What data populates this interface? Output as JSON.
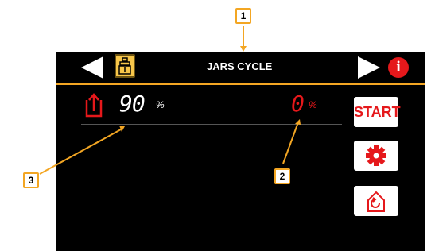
{
  "header": {
    "title": "JARS CYCLE",
    "info_label": "i"
  },
  "readouts": {
    "left_value": "90",
    "left_unit": "%",
    "right_value": "0",
    "right_unit": "%"
  },
  "buttons": {
    "start_label": "START"
  },
  "callouts": [
    "1",
    "2",
    "3"
  ],
  "colors": {
    "accent_orange": "#f3a623",
    "alert_red": "#e5181b",
    "mode_yellow": "#f7c64a"
  },
  "icons": {
    "prev": "arrow-left-icon",
    "next": "arrow-right-icon",
    "mode": "jar-mode-icon",
    "info": "info-icon",
    "unload": "unload-icon",
    "settings": "gear-icon",
    "home": "home-cycle-icon"
  }
}
